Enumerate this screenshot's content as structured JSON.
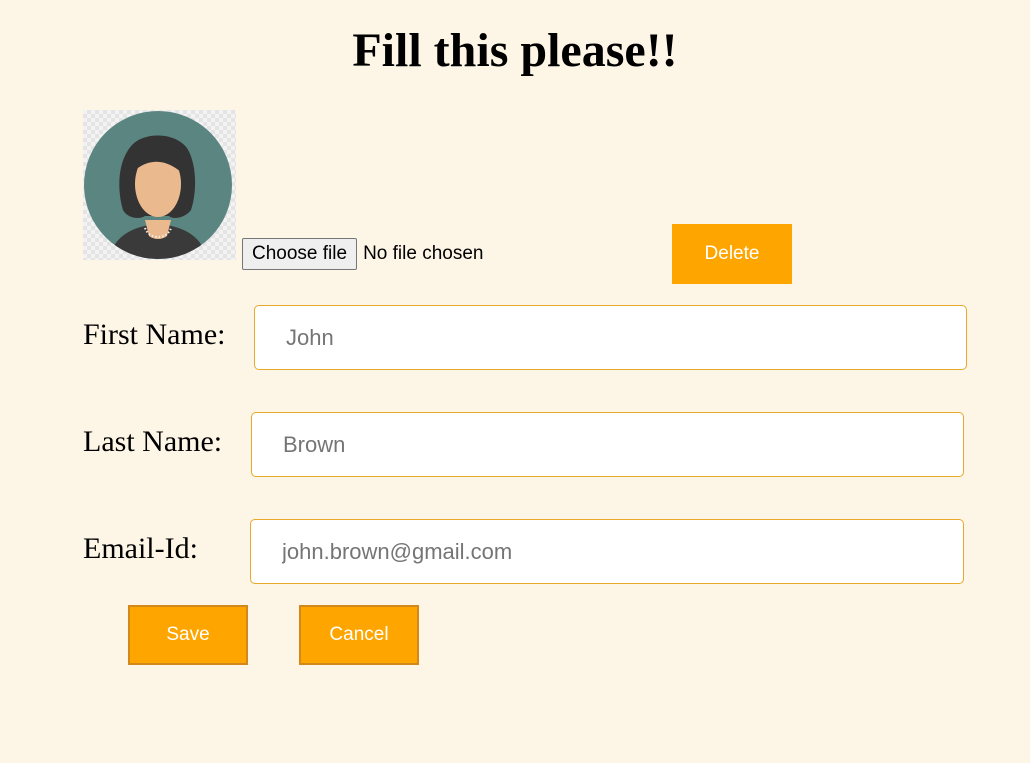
{
  "page": {
    "title": "Fill this please!!"
  },
  "photo": {
    "avatar_icon": "woman-avatar-icon",
    "choose_file_label": "Choose file",
    "file_status": "No file chosen",
    "delete_label": "Delete"
  },
  "form": {
    "first_name": {
      "label": "First Name:",
      "value": "",
      "placeholder": "John"
    },
    "last_name": {
      "label": "Last Name:",
      "value": "",
      "placeholder": "Brown"
    },
    "email": {
      "label": "Email-Id:",
      "value": "",
      "placeholder": "john.brown@gmail.com"
    }
  },
  "actions": {
    "save_label": "Save",
    "cancel_label": "Cancel"
  },
  "colors": {
    "page_background": "#fdf5e6",
    "accent": "#ffa500",
    "field_border": "#e8a92a",
    "button_text": "#ffffff"
  }
}
